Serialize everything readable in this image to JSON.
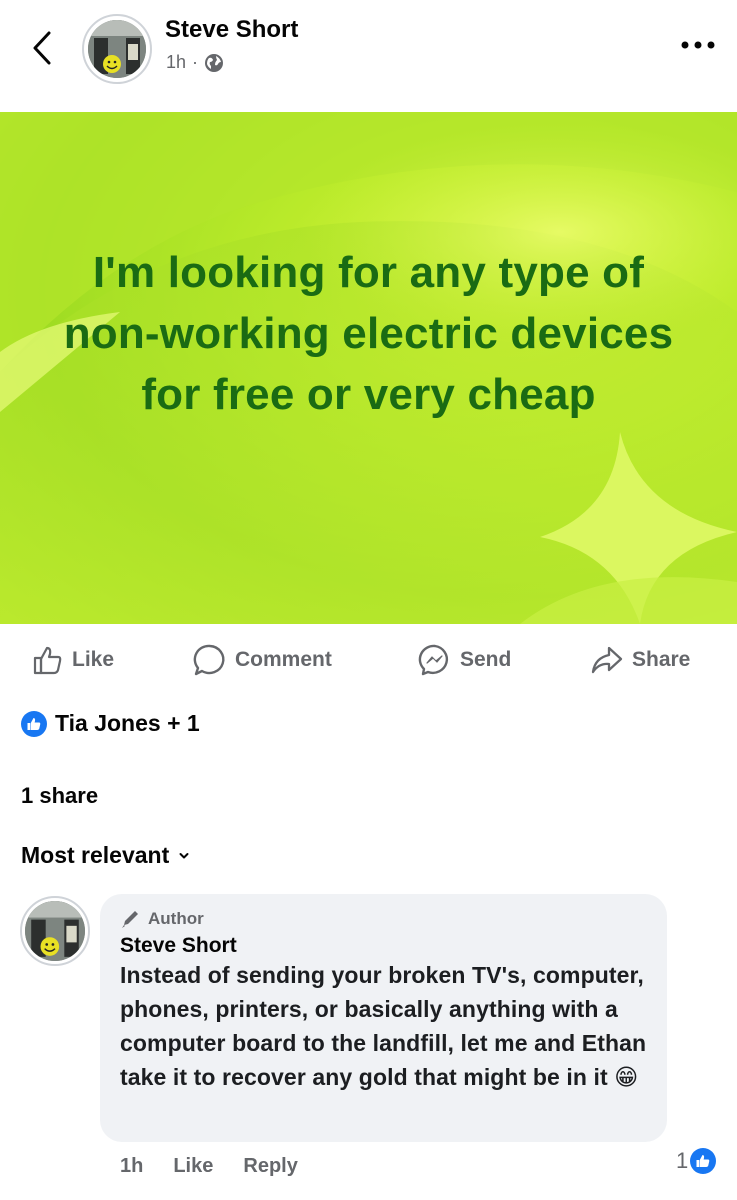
{
  "header": {
    "author": "Steve Short",
    "time": "1h",
    "separator": "·",
    "audience_icon": "globe-icon"
  },
  "post": {
    "text": "I'm looking for any type of non-working electric devices for free or very cheap",
    "background_colors": [
      "#b9ea2a",
      "#d8f53a",
      "#9fdc22"
    ],
    "text_color": "#1a6b13"
  },
  "actions": {
    "like": "Like",
    "comment": "Comment",
    "send": "Send",
    "share": "Share"
  },
  "reactions": {
    "label": "Tia Jones + 1",
    "icon": "like-reaction-icon"
  },
  "shares": "1 share",
  "sort": {
    "label": "Most relevant"
  },
  "comment": {
    "badge": "Author",
    "name": "Steve Short",
    "text": "Instead of sending your broken TV's, computer, phones, printers, or basically anything with a computer board to the landfill, let me and Ethan take it to recover any gold that might be in it",
    "emoji": "😁",
    "time": "1h",
    "like": "Like",
    "reply": "Reply",
    "reaction_count": "1"
  },
  "colors": {
    "accent": "#1877f2",
    "secondary_text": "#65676b",
    "bubble": "#f0f2f5"
  }
}
